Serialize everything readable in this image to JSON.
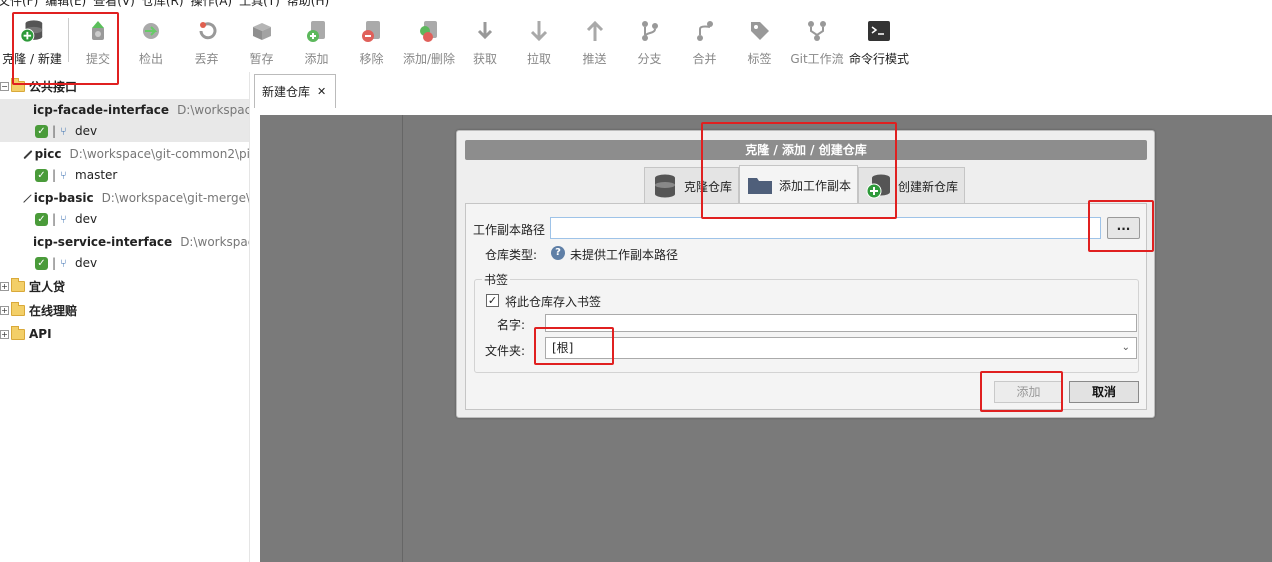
{
  "menu": [
    "文件(F)",
    "编辑(E)",
    "查看(V)",
    "仓库(R)",
    "操作(A)",
    "工具(T)",
    "帮助(H)"
  ],
  "toolbar": {
    "clone_new": "克隆 / 新建",
    "commit": "提交",
    "checkout": "检出",
    "discard": "丢弃",
    "stash": "暂存",
    "add": "添加",
    "remove": "移除",
    "add_remove": "添加/删除",
    "fetch": "获取",
    "pull": "拉取",
    "push": "推送",
    "branch": "分支",
    "merge": "合并",
    "tag": "标签",
    "git_flow": "Git工作流",
    "terminal": "命令行模式"
  },
  "tree": {
    "groups": [
      {
        "label": "公共接口",
        "expanded": true
      },
      {
        "label": "宜人贷",
        "expanded": false
      },
      {
        "label": "在线理赔",
        "expanded": false
      },
      {
        "label": "API",
        "expanded": false
      }
    ],
    "repos": [
      {
        "name": "icp-facade-interface",
        "path": "D:\\workspace",
        "branch": "dev"
      },
      {
        "name": "picc",
        "path": "D:\\workspace\\git-common2\\pi",
        "branch": "master"
      },
      {
        "name": "icp-basic",
        "path": "D:\\workspace\\git-merge\\",
        "branch": "dev"
      },
      {
        "name": "icp-service-interface",
        "path": "D:\\workspace",
        "branch": "dev"
      }
    ]
  },
  "doc_tab": {
    "label": "新建仓库",
    "close": "✕"
  },
  "dialog": {
    "title": "克隆 / 添加 / 创建仓库",
    "tabs": {
      "clone": "克隆仓库",
      "add_working_copy": "添加工作副本",
      "create": "创建新仓库"
    },
    "working_copy_path_label": "工作副本路径",
    "working_copy_path_value": "",
    "browse_label": "...",
    "repo_type_label": "仓库类型:",
    "repo_type_value": "未提供工作副本路径",
    "bookmark_group_label": "书签",
    "save_bookmark_label": "将此仓库存入书签",
    "save_bookmark_checked": true,
    "name_label": "名字:",
    "name_value": "",
    "folder_label": "文件夹:",
    "folder_value": "[根]",
    "add_button": "添加",
    "cancel_button": "取消"
  },
  "colors": {
    "annotation": "#e02020",
    "workspace_bg": "#7a7a7a",
    "dialog_title_bg": "#8d8d8d"
  }
}
